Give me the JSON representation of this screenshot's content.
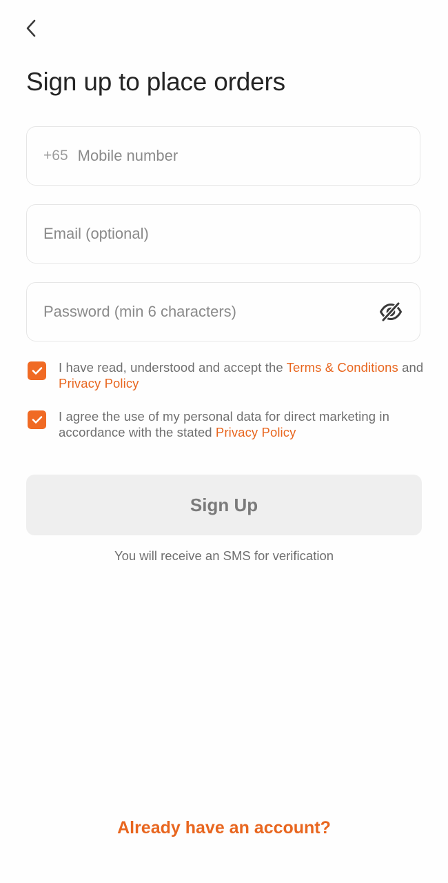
{
  "header": {
    "back_icon": "chevron-left-icon",
    "title": "Sign up to place orders"
  },
  "form": {
    "mobile": {
      "country_code": "+65",
      "placeholder": "Mobile number",
      "value": ""
    },
    "email": {
      "placeholder": "Email (optional)",
      "value": ""
    },
    "password": {
      "placeholder": "Password (min 6 characters)",
      "value": "",
      "toggle_icon": "eye-off-icon"
    }
  },
  "consents": [
    {
      "checked": true,
      "text_before": "I have read, understood and accept the ",
      "link1": "Terms & Conditions",
      "text_middle": " and ",
      "link2": "Privacy Policy"
    },
    {
      "checked": true,
      "text_before": "I agree the use of my personal data for direct marketing in accordance with the stated ",
      "link1": "Privacy Policy"
    }
  ],
  "signup": {
    "button_label": "Sign Up",
    "note": "You will receive an SMS for verification"
  },
  "footer": {
    "login_link": "Already have an account?"
  },
  "colors": {
    "accent": "#f06a24",
    "link": "#e8661f",
    "button_disabled_bg": "#efefef",
    "border": "#e6e6e6"
  }
}
